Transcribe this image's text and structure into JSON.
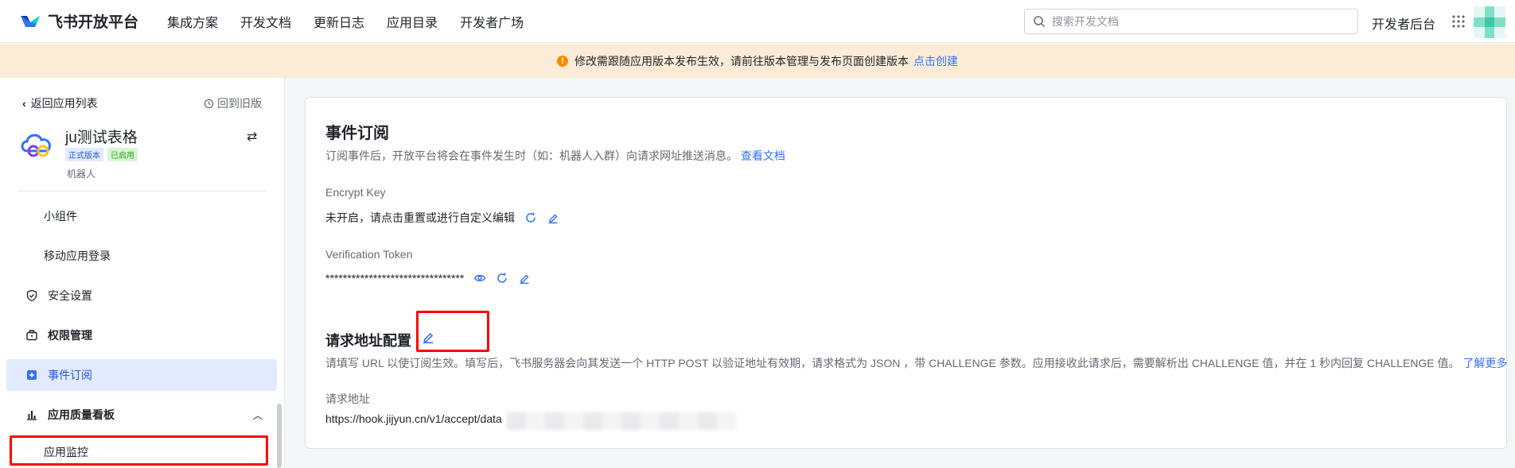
{
  "topbar": {
    "logo_text": "飞书开放平台",
    "nav": [
      "集成方案",
      "开发文档",
      "更新日志",
      "应用目录",
      "开发者广场"
    ],
    "search_placeholder": "搜索开发文档",
    "dev_console": "开发者后台"
  },
  "banner": {
    "icon": "!",
    "text": "修改需跟随应用版本发布生效，请前往版本管理与发布页面创建版本",
    "link": "点击创建"
  },
  "sidebar": {
    "back": "返回应用列表",
    "old_version": "回到旧版",
    "app": {
      "name": "ju测试表格",
      "badge_prod": "正式版本",
      "badge_enabled": "已启用",
      "type": "机器人"
    },
    "items": [
      {
        "label": "小组件"
      },
      {
        "label": "移动应用登录"
      },
      {
        "label": "安全设置"
      },
      {
        "label": "权限管理"
      },
      {
        "label": "事件订阅"
      },
      {
        "label": "应用质量看板"
      },
      {
        "label": "应用监控"
      }
    ]
  },
  "main": {
    "title": "事件订阅",
    "desc": "订阅事件后，开放平台将会在事件发生时（如：机器人入群）向请求网址推送消息。",
    "desc_link": "查看文档",
    "encrypt_key_label": "Encrypt Key",
    "encrypt_key_value": "未开启，请点击重置或进行自定义编辑",
    "token_label": "Verification Token",
    "token_value": "********************************",
    "url_section_title": "请求地址配置",
    "url_section_desc": "请填写 URL 以使订阅生效。填写后，飞书服务器会向其发送一个 HTTP POST 以验证地址有效期，请求格式为 JSON ，带 CHALLENGE 参数。应用接收此请求后，需要解析出 CHALLENGE 值，并在 1 秒内回复 CHALLENGE 值。",
    "url_section_link": "了解更多",
    "url_label": "请求地址",
    "url_value": "https://hook.jijyun.cn/v1/accept/data"
  },
  "colors": {
    "accent": "#3370ff",
    "banner_bg": "#fcecd7",
    "highlight_box": "#ff0000"
  }
}
